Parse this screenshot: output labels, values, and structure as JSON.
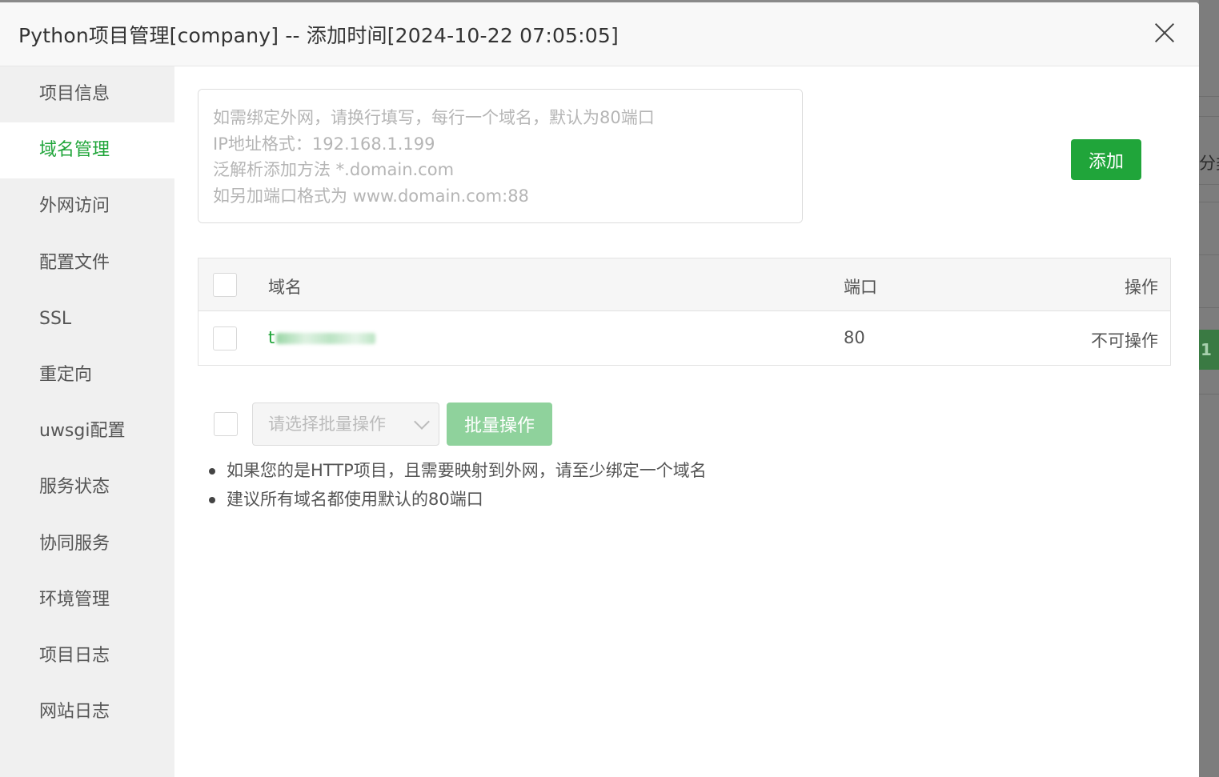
{
  "dialog": {
    "title": "Python项目管理[company] -- 添加时间[2024-10-22 07:05:05]"
  },
  "background": {
    "partial_text": "分类",
    "partial_badge": "1"
  },
  "sidebar": {
    "items": [
      {
        "label": "项目信息",
        "active": false
      },
      {
        "label": "域名管理",
        "active": true
      },
      {
        "label": "外网访问",
        "active": false
      },
      {
        "label": "配置文件",
        "active": false
      },
      {
        "label": "SSL",
        "active": false
      },
      {
        "label": "重定向",
        "active": false
      },
      {
        "label": "uwsgi配置",
        "active": false
      },
      {
        "label": "服务状态",
        "active": false
      },
      {
        "label": "协同服务",
        "active": false
      },
      {
        "label": "环境管理",
        "active": false
      },
      {
        "label": "项目日志",
        "active": false
      },
      {
        "label": "网站日志",
        "active": false
      }
    ]
  },
  "domain_form": {
    "placeholder": "如需绑定外网，请换行填写，每行一个域名，默认为80端口\nIP地址格式：192.168.1.199\n泛解析添加方法 *.domain.com\n如另加端口格式为 www.domain.com:88",
    "add_label": "添加"
  },
  "table": {
    "headers": {
      "domain": "域名",
      "port": "端口",
      "action": "操作"
    },
    "rows": [
      {
        "domain": "t",
        "port": "80",
        "action": "不可操作"
      }
    ]
  },
  "batch": {
    "select_placeholder": "请选择批量操作",
    "button_label": "批量操作"
  },
  "tips": [
    "如果您的是HTTP项目，且需要映射到外网，请至少绑定一个域名",
    "建议所有域名都使用默认的80端口"
  ],
  "colors": {
    "accent": "#20a53a",
    "accent_disabled": "#8fd29c"
  }
}
